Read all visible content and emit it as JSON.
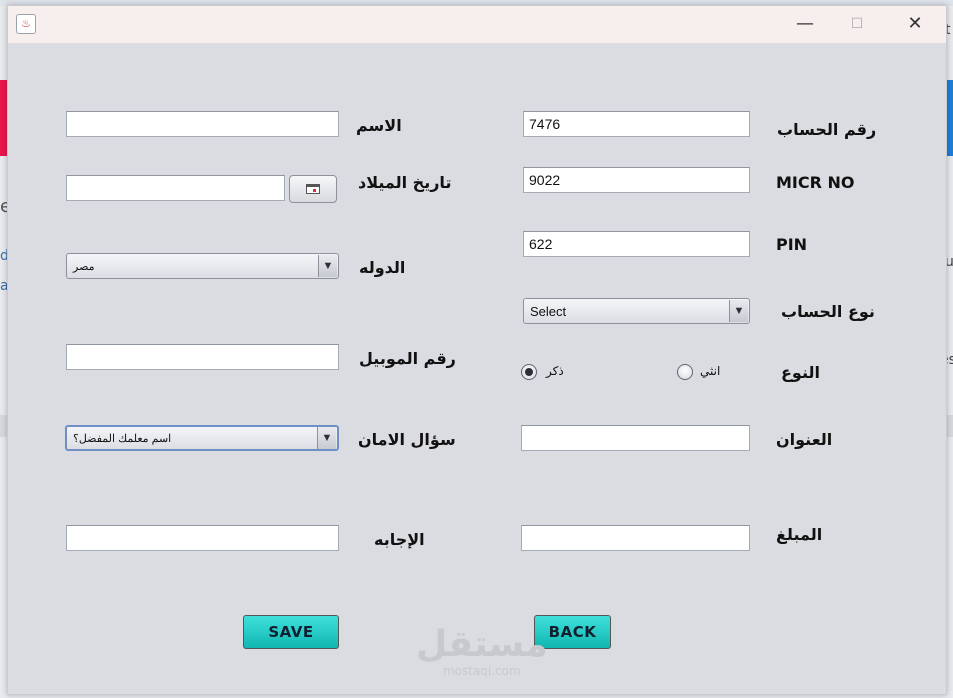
{
  "window": {
    "title_icon": "java-cup-icon",
    "minimize": "—",
    "maximize": "☐",
    "close": "✕"
  },
  "background": {
    "glyph_e": "e",
    "glyph_d": "d",
    "glyph_a": "a",
    "glyph_u": "u",
    "glyph_es": "es",
    "glyph_t": "t"
  },
  "left_form": {
    "name_label": "الاسم",
    "name_value": "",
    "dob_label": "تاريخ الميلاد",
    "dob_value": "",
    "country_label": "الدوله",
    "country_selected": "مصر",
    "mobile_label": "رقم الموبيل",
    "mobile_value": "",
    "security_label": "سؤال الامان",
    "security_selected": "اسم معلمك المفضل؟",
    "answer_label": "الإجابه",
    "answer_value": ""
  },
  "right_form": {
    "account_no_label": "رقم الحساب",
    "account_no_value": "7476",
    "micr_label": "MICR NO",
    "micr_value": "9022",
    "pin_label": "PIN",
    "pin_value": "622",
    "account_type_label": "نوع الحساب",
    "account_type_selected": "Select",
    "gender_label": "النوع",
    "gender_male": "ذكر",
    "gender_female": "انثي",
    "gender_selected": "male",
    "address_label": "العنوان",
    "address_value": "",
    "amount_label": "المبلغ",
    "amount_value": ""
  },
  "buttons": {
    "save": "SAVE",
    "back": "BACK"
  },
  "watermark": {
    "main": "مستقل",
    "sub": "mostaqi.com"
  },
  "colors": {
    "button_accent": "#1fcac5",
    "title_bar": "#f7eeee",
    "panel": "#dadce1"
  }
}
